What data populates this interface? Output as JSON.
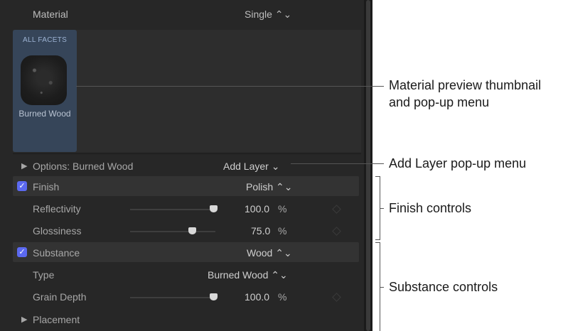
{
  "header": {
    "label": "Material",
    "value": "Single ⌃⌄"
  },
  "facet_tile": {
    "tag": "ALL FACETS",
    "name": "Burned Wood"
  },
  "options": {
    "label": "Options: Burned Wood",
    "add_layer": "Add Layer ⌄"
  },
  "finish": {
    "title": "Finish",
    "value": "Polish ⌃⌄",
    "checked": true,
    "params": [
      {
        "label": "Reflectivity",
        "value": "100.0",
        "unit": "%",
        "level": 1.0
      },
      {
        "label": "Glossiness",
        "value": "75.0",
        "unit": "%",
        "level": 0.75
      }
    ]
  },
  "substance": {
    "title": "Substance",
    "value": "Wood ⌃⌄",
    "checked": true,
    "type_label": "Type",
    "type_value": "Burned Wood ⌃⌄",
    "grain_label": "Grain Depth",
    "grain_value": "100.0",
    "grain_unit": "%",
    "grain_level": 1.0
  },
  "placement": {
    "label": "Placement"
  },
  "annotations": {
    "thumbnail_line1": "Material preview thumbnail",
    "thumbnail_line2": "and pop-up menu",
    "add_layer": "Add Layer pop-up menu",
    "finish": "Finish controls",
    "substance": "Substance controls"
  },
  "colors": {
    "panel": "#272727",
    "checkbox": "#5b69f0",
    "tile": "#364559"
  }
}
